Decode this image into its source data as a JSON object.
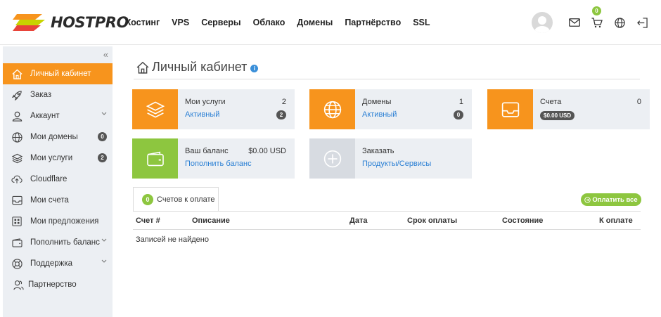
{
  "brand": {
    "name": "HOSTPRO"
  },
  "nav": {
    "items": [
      "Хостинг",
      "VPS",
      "Серверы",
      "Облако",
      "Домены",
      "Партнёрство",
      "SSL"
    ]
  },
  "header": {
    "cart_count": "0"
  },
  "sidebar": {
    "collapse_glyph": "«",
    "items": [
      {
        "label": "Личный кабинет",
        "icon": "home-icon"
      },
      {
        "label": "Заказ",
        "icon": "rocket-icon"
      },
      {
        "label": "Аккаунт",
        "icon": "user-icon"
      },
      {
        "label": "Мои домены",
        "icon": "globe-icon",
        "badge": "0"
      },
      {
        "label": "Мои услуги",
        "icon": "layers-icon",
        "badge": "2"
      },
      {
        "label": "Cloudflare",
        "icon": "cloud-upload-icon"
      },
      {
        "label": "Мои счета",
        "icon": "inbox-icon"
      },
      {
        "label": "Мои предложения",
        "icon": "grid-icon"
      },
      {
        "label": "Пополнить баланс",
        "icon": "wallet-icon"
      },
      {
        "label": "Поддержка",
        "icon": "lifebuoy-icon"
      },
      {
        "label": "Партнерство",
        "icon": "partner-icon"
      }
    ]
  },
  "page": {
    "title": "Личный кабинет",
    "info_glyph": "i"
  },
  "cards": {
    "services": {
      "label": "Мои услуги",
      "value": "2",
      "link": "Активный",
      "badge": "2"
    },
    "domains": {
      "label": "Домены",
      "value": "1",
      "link": "Активный",
      "badge": "0"
    },
    "invoices": {
      "label": "Счета",
      "value": "0",
      "amount": "$0.00 USD"
    },
    "balance": {
      "label": "Ваш баланс",
      "value": "$0.00 USD",
      "link": "Пополнить баланс"
    },
    "order": {
      "label": "Заказать",
      "link": "Продукты/Сервисы"
    }
  },
  "invoices_tab": {
    "count": "0",
    "label": "Счетов к оплате",
    "pay_all": "Оплатить все"
  },
  "table": {
    "headers": [
      "Счет #",
      "Описание",
      "Дата",
      "Срок оплаты",
      "Состояние",
      "К оплате"
    ],
    "empty": "Записей не найдено"
  },
  "colors": {
    "orange": "#f7941d",
    "green": "#8dc63f",
    "grey_card": "#d7dbe1",
    "link": "#2a7fd4"
  }
}
